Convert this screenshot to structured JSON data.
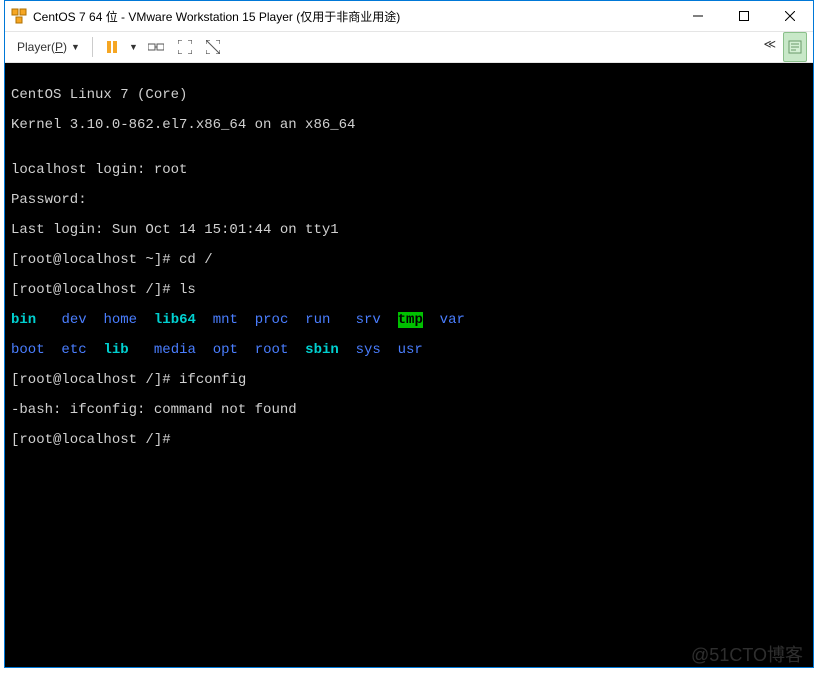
{
  "window": {
    "title": "CentOS 7 64 位 - VMware Workstation 15 Player (仅用于非商业用途)"
  },
  "toolbar": {
    "player_label": "Player(P)",
    "player_hotkey": "P"
  },
  "terminal": {
    "line1": "CentOS Linux 7 (Core)",
    "line2": "Kernel 3.10.0-862.el7.x86_64 on an x86_64",
    "line3": "",
    "login_prompt": "localhost login: root",
    "password_prompt": "Password:",
    "last_login": "Last login: Sun Oct 14 15:01:44 on tty1",
    "prompt1": "[root@localhost ~]# cd /",
    "prompt2": "[root@localhost /]# ls",
    "ls_row1": [
      {
        "text": "bin",
        "class": "c-cyan",
        "pad": 6
      },
      {
        "text": "dev",
        "class": "c-blue",
        "pad": 5
      },
      {
        "text": "home",
        "class": "c-blue",
        "pad": 6
      },
      {
        "text": "lib64",
        "class": "c-cyan",
        "pad": 7
      },
      {
        "text": "mnt",
        "class": "c-blue",
        "pad": 5
      },
      {
        "text": "proc",
        "class": "c-blue",
        "pad": 6
      },
      {
        "text": "run",
        "class": "c-blue",
        "pad": 6
      },
      {
        "text": "srv",
        "class": "c-blue",
        "pad": 5
      },
      {
        "text": "tmp",
        "class": "c-green-bg",
        "pad": 3
      },
      {
        "text": "  var",
        "class": "c-blue",
        "pad": 0
      }
    ],
    "ls_row2": [
      {
        "text": "boot",
        "class": "c-blue",
        "pad": 6
      },
      {
        "text": "etc",
        "class": "c-blue",
        "pad": 5
      },
      {
        "text": "lib",
        "class": "c-cyan",
        "pad": 6
      },
      {
        "text": "media",
        "class": "c-blue",
        "pad": 7
      },
      {
        "text": "opt",
        "class": "c-blue",
        "pad": 5
      },
      {
        "text": "root",
        "class": "c-blue",
        "pad": 6
      },
      {
        "text": "sbin",
        "class": "c-cyan",
        "pad": 6
      },
      {
        "text": "sys",
        "class": "c-blue",
        "pad": 5
      },
      {
        "text": "usr",
        "class": "c-blue",
        "pad": 0
      }
    ],
    "prompt3": "[root@localhost /]# ifconfig",
    "error_line": "-bash: ifconfig: command not found",
    "prompt4": "[root@localhost /]# "
  },
  "watermark": "@51CTO博客"
}
